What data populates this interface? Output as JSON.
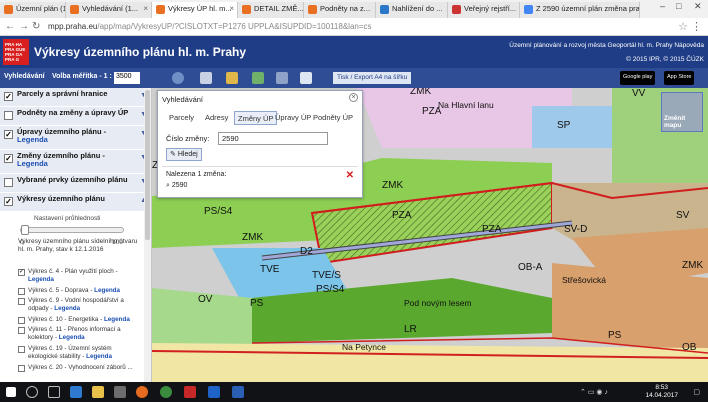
{
  "browser": {
    "tabs": [
      {
        "label": "Územní plán (1...",
        "active": false,
        "color": "#e96f21"
      },
      {
        "label": "Vyhledávání (1...",
        "active": false,
        "color": "#e96f21"
      },
      {
        "label": "Výkresy ÚP hl. m...",
        "active": true,
        "color": "#e96f21"
      },
      {
        "label": "DETAIL ZMĚ...",
        "active": false,
        "color": "#e96f21"
      },
      {
        "label": "Podněty na z...",
        "active": false,
        "color": "#e96f21"
      },
      {
        "label": "Nahlížení do ...",
        "active": false,
        "color": "#2b78c8"
      },
      {
        "label": "Veřejný rejstří...",
        "active": false,
        "color": "#c33"
      },
      {
        "label": "Z 2590 územní plán změna praha",
        "active": false,
        "color": "#4285f4"
      }
    ],
    "url_host": "mpp.praha.eu",
    "url_path": "/app/map/VykresyUP/?CISLOTXT=P1276 UPPLA&ISUPDID=100118&lan=cs"
  },
  "header": {
    "logo_text": "PRA HA PRA GUE PRA GA PRA G",
    "title": "Výkresy územního plánu hl. m. Prahy",
    "links": "Územní plánování a rozvoj města  Geoportál hl. m. Prahy  Nápověda",
    "copyright": "© 2015 IPR, © 2015 ČÚZK"
  },
  "toolbar": {
    "search_label": "Vyhledávání",
    "scale_label": "Volba měřítka - 1 :",
    "scale_value": "3500",
    "export_label": "Tisk / Export A4 na šířku",
    "google_play": "Google play",
    "app_store": "App Store"
  },
  "sidebar": {
    "layers": [
      {
        "label": "Parcely a správní hranice",
        "checked": true
      },
      {
        "label": "Podněty na změny a úpravy ÚP",
        "checked": false
      },
      {
        "label": "Úpravy územního plánu -",
        "legend": "Legenda",
        "checked": true
      },
      {
        "label": "Změny územního plánu -",
        "legend": "Legenda",
        "checked": true
      },
      {
        "label": "Vybrané prvky územního plánu",
        "checked": false
      },
      {
        "label": "Výkresy územního plánu",
        "checked": true
      }
    ],
    "transparency_label": "Nastavení průhlednosti",
    "transparency_min": "0",
    "transparency_max": "100",
    "transparency_value": 0.05,
    "description": "Výkresy územního plánu sídelního útvaru hl. m. Prahy, stav k 12.1.2016",
    "plans": [
      {
        "text": "Výkres č. 4 - Plán využití ploch -",
        "legend": "Legenda",
        "checked": true
      },
      {
        "text": "Výkres č. 5 - Doprava -",
        "legend": "Legenda",
        "checked": false
      },
      {
        "text": "Výkres č. 9 - Vodní hospodářství a odpady -",
        "legend": "Legenda",
        "checked": false
      },
      {
        "text": "Výkres č. 10 - Energetika -",
        "legend": "Legenda",
        "checked": false
      },
      {
        "text": "Výkres č. 11 - Přenos informací a kolektory -",
        "legend": "Legenda",
        "checked": false
      },
      {
        "text": "Výkres č. 19 - Územní systém ekologické stability -",
        "legend": "Legenda",
        "checked": false
      },
      {
        "text": "Výkres č. 20 - Vyhodnocení záborů ...",
        "legend": "",
        "checked": false
      }
    ]
  },
  "search_panel": {
    "title": "Vyhledávání",
    "tabs": [
      "Parcely",
      "Adresy",
      "Změny ÚP",
      "Úpravy ÚP",
      "Podněty ÚP"
    ],
    "active_tab": "Změny ÚP",
    "field_label": "Číslo změny:",
    "field_value": "2590",
    "button_label": "Hledej",
    "found_label": "Nalezena 1 změna:",
    "result": "2590"
  },
  "map": {
    "change_map_label": "Změnit mapu",
    "zones": [
      "ZMK",
      "VV",
      "SP",
      "ZMK",
      "PZA",
      "PZA",
      "SV",
      "SV-D",
      "OB-A",
      "TVE",
      "TVE/S",
      "PS",
      "ZMK",
      "OV",
      "PS",
      "LR",
      "OB",
      "D2",
      "PS/S4",
      "PS/S4",
      "ZMK",
      "ZMK",
      "PZA"
    ],
    "streets": [
      "Na Hlavní lanu",
      "Střešovická",
      "Pod novým lesem",
      "Na Petynce"
    ]
  },
  "taskbar": {
    "time": "8:53",
    "date": "14.04.2017"
  }
}
